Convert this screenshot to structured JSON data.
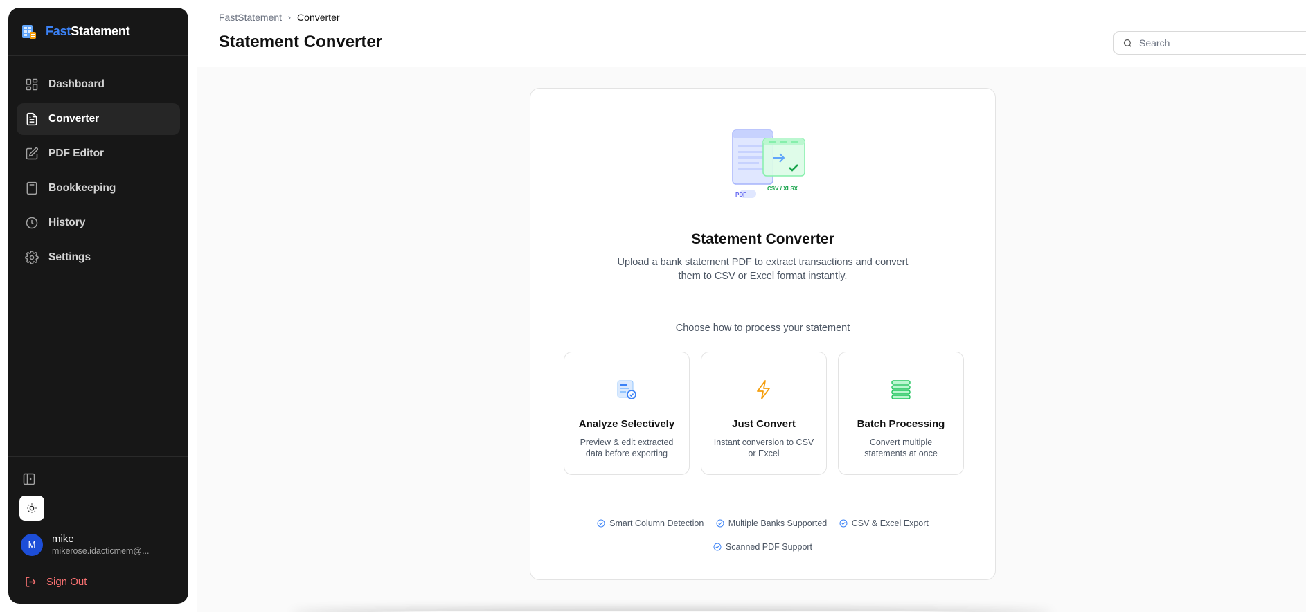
{
  "brand": {
    "name_part1": "Fast",
    "name_part2": "Statement"
  },
  "sidebar": {
    "items": [
      {
        "label": "Dashboard",
        "icon": "dashboard-icon",
        "active": false
      },
      {
        "label": "Converter",
        "icon": "document-icon",
        "active": true
      },
      {
        "label": "PDF Editor",
        "icon": "edit-icon",
        "active": false
      },
      {
        "label": "Bookkeeping",
        "icon": "calculator-icon",
        "active": false
      },
      {
        "label": "History",
        "icon": "clock-icon",
        "active": false
      },
      {
        "label": "Settings",
        "icon": "gear-icon",
        "active": false
      }
    ],
    "user": {
      "initial": "M",
      "name": "mike",
      "email": "mikerose.idacticmem@..."
    },
    "sign_out_label": "Sign Out"
  },
  "header": {
    "breadcrumb": {
      "root": "FastStatement",
      "current": "Converter"
    },
    "title": "Statement Converter",
    "search_placeholder": "Search"
  },
  "card": {
    "illustration": {
      "pdf_label": "PDF",
      "output_label": "CSV / XLSX"
    },
    "title": "Statement Converter",
    "description": "Upload a bank statement PDF to extract transactions and convert them to CSV or Excel format instantly.",
    "choose_label": "Choose how to process your statement",
    "options": [
      {
        "title": "Analyze Selectively",
        "desc": "Preview & edit extracted data before exporting",
        "icon": "analyze-icon"
      },
      {
        "title": "Just Convert",
        "desc": "Instant conversion to CSV or Excel",
        "icon": "lightning-icon"
      },
      {
        "title": "Batch Processing",
        "desc": "Convert multiple statements at once",
        "icon": "stack-icon"
      }
    ],
    "features": [
      "Smart Column Detection",
      "Multiple Banks Supported",
      "CSV & Excel Export",
      "Scanned PDF Support"
    ]
  },
  "colors": {
    "accent": "#3b82f6",
    "sidebar_bg": "#171717",
    "danger": "#f87171",
    "success": "#22c55e",
    "warning": "#f59e0b"
  }
}
